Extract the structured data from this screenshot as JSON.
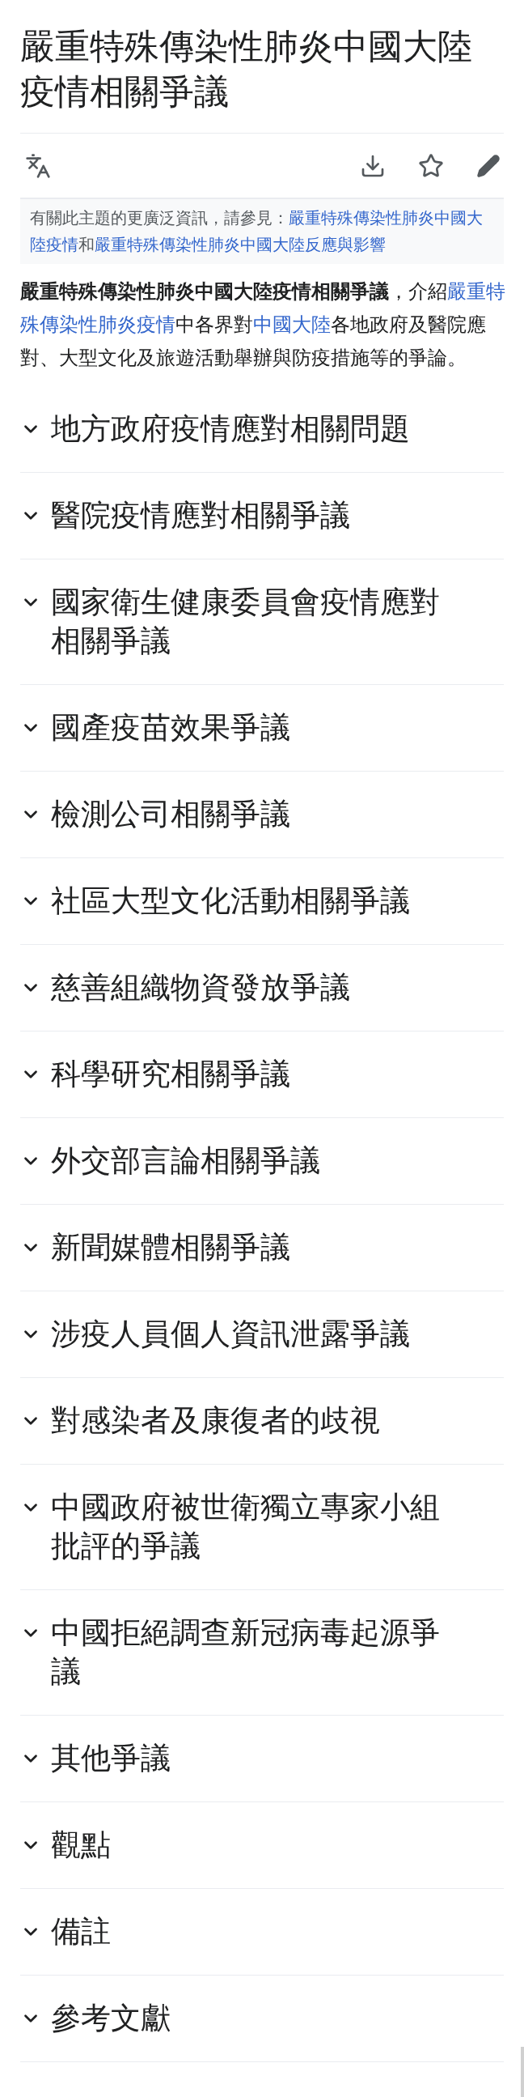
{
  "title": "嚴重特殊傳染性肺炎中國大陸疫情相關爭議",
  "hatnote": [
    {
      "kind": "plain",
      "text": "有關此主題的更廣泛資訊，請參見："
    },
    {
      "kind": "link",
      "text": "嚴重特殊傳染性肺炎中國大陸疫情"
    },
    {
      "kind": "plain",
      "text": "和"
    },
    {
      "kind": "link",
      "text": "嚴重特殊傳染性肺炎中國大陸反應與影響"
    }
  ],
  "lead": [
    {
      "kind": "bold",
      "text": "嚴重特殊傳染性肺炎中國大陸疫情相關爭議"
    },
    {
      "kind": "plain",
      "text": "，介紹"
    },
    {
      "kind": "link",
      "text": "嚴重特殊傳染性肺炎疫情"
    },
    {
      "kind": "plain",
      "text": "中各界對"
    },
    {
      "kind": "link",
      "text": "中國大陸"
    },
    {
      "kind": "plain",
      "text": "各地政府及醫院應對、大型文化及旅遊活動舉辦與防疫措施等的爭論。"
    }
  ],
  "sections": [
    {
      "title": "地方政府疫情應對相關問題",
      "expanded": false
    },
    {
      "title": "醫院疫情應對相關爭議",
      "expanded": false
    },
    {
      "title": "國家衛生健康委員會疫情應對相關爭議",
      "expanded": false
    },
    {
      "title": "國產疫苗效果爭議",
      "expanded": false
    },
    {
      "title": "檢測公司相關爭議",
      "expanded": false
    },
    {
      "title": "社區大型文化活動相關爭議",
      "expanded": false
    },
    {
      "title": "慈善組織物資發放爭議",
      "expanded": false
    },
    {
      "title": "科學研究相關爭議",
      "expanded": false
    },
    {
      "title": "外交部言論相關爭議",
      "expanded": false
    },
    {
      "title": "新聞媒體相關爭議",
      "expanded": false
    },
    {
      "title": "涉疫人員個人資訊泄露爭議",
      "expanded": false
    },
    {
      "title": "對感染者及康復者的歧視",
      "expanded": false
    },
    {
      "title": "中國政府被世衛獨立專家小組批評的爭議",
      "expanded": false
    },
    {
      "title": "中國拒絕調查新冠病毒起源爭議",
      "expanded": false
    },
    {
      "title": "其他爭議",
      "expanded": false
    },
    {
      "title": "觀點",
      "expanded": false
    },
    {
      "title": "備註",
      "expanded": false
    },
    {
      "title": "參考文獻",
      "expanded": false
    }
  ]
}
